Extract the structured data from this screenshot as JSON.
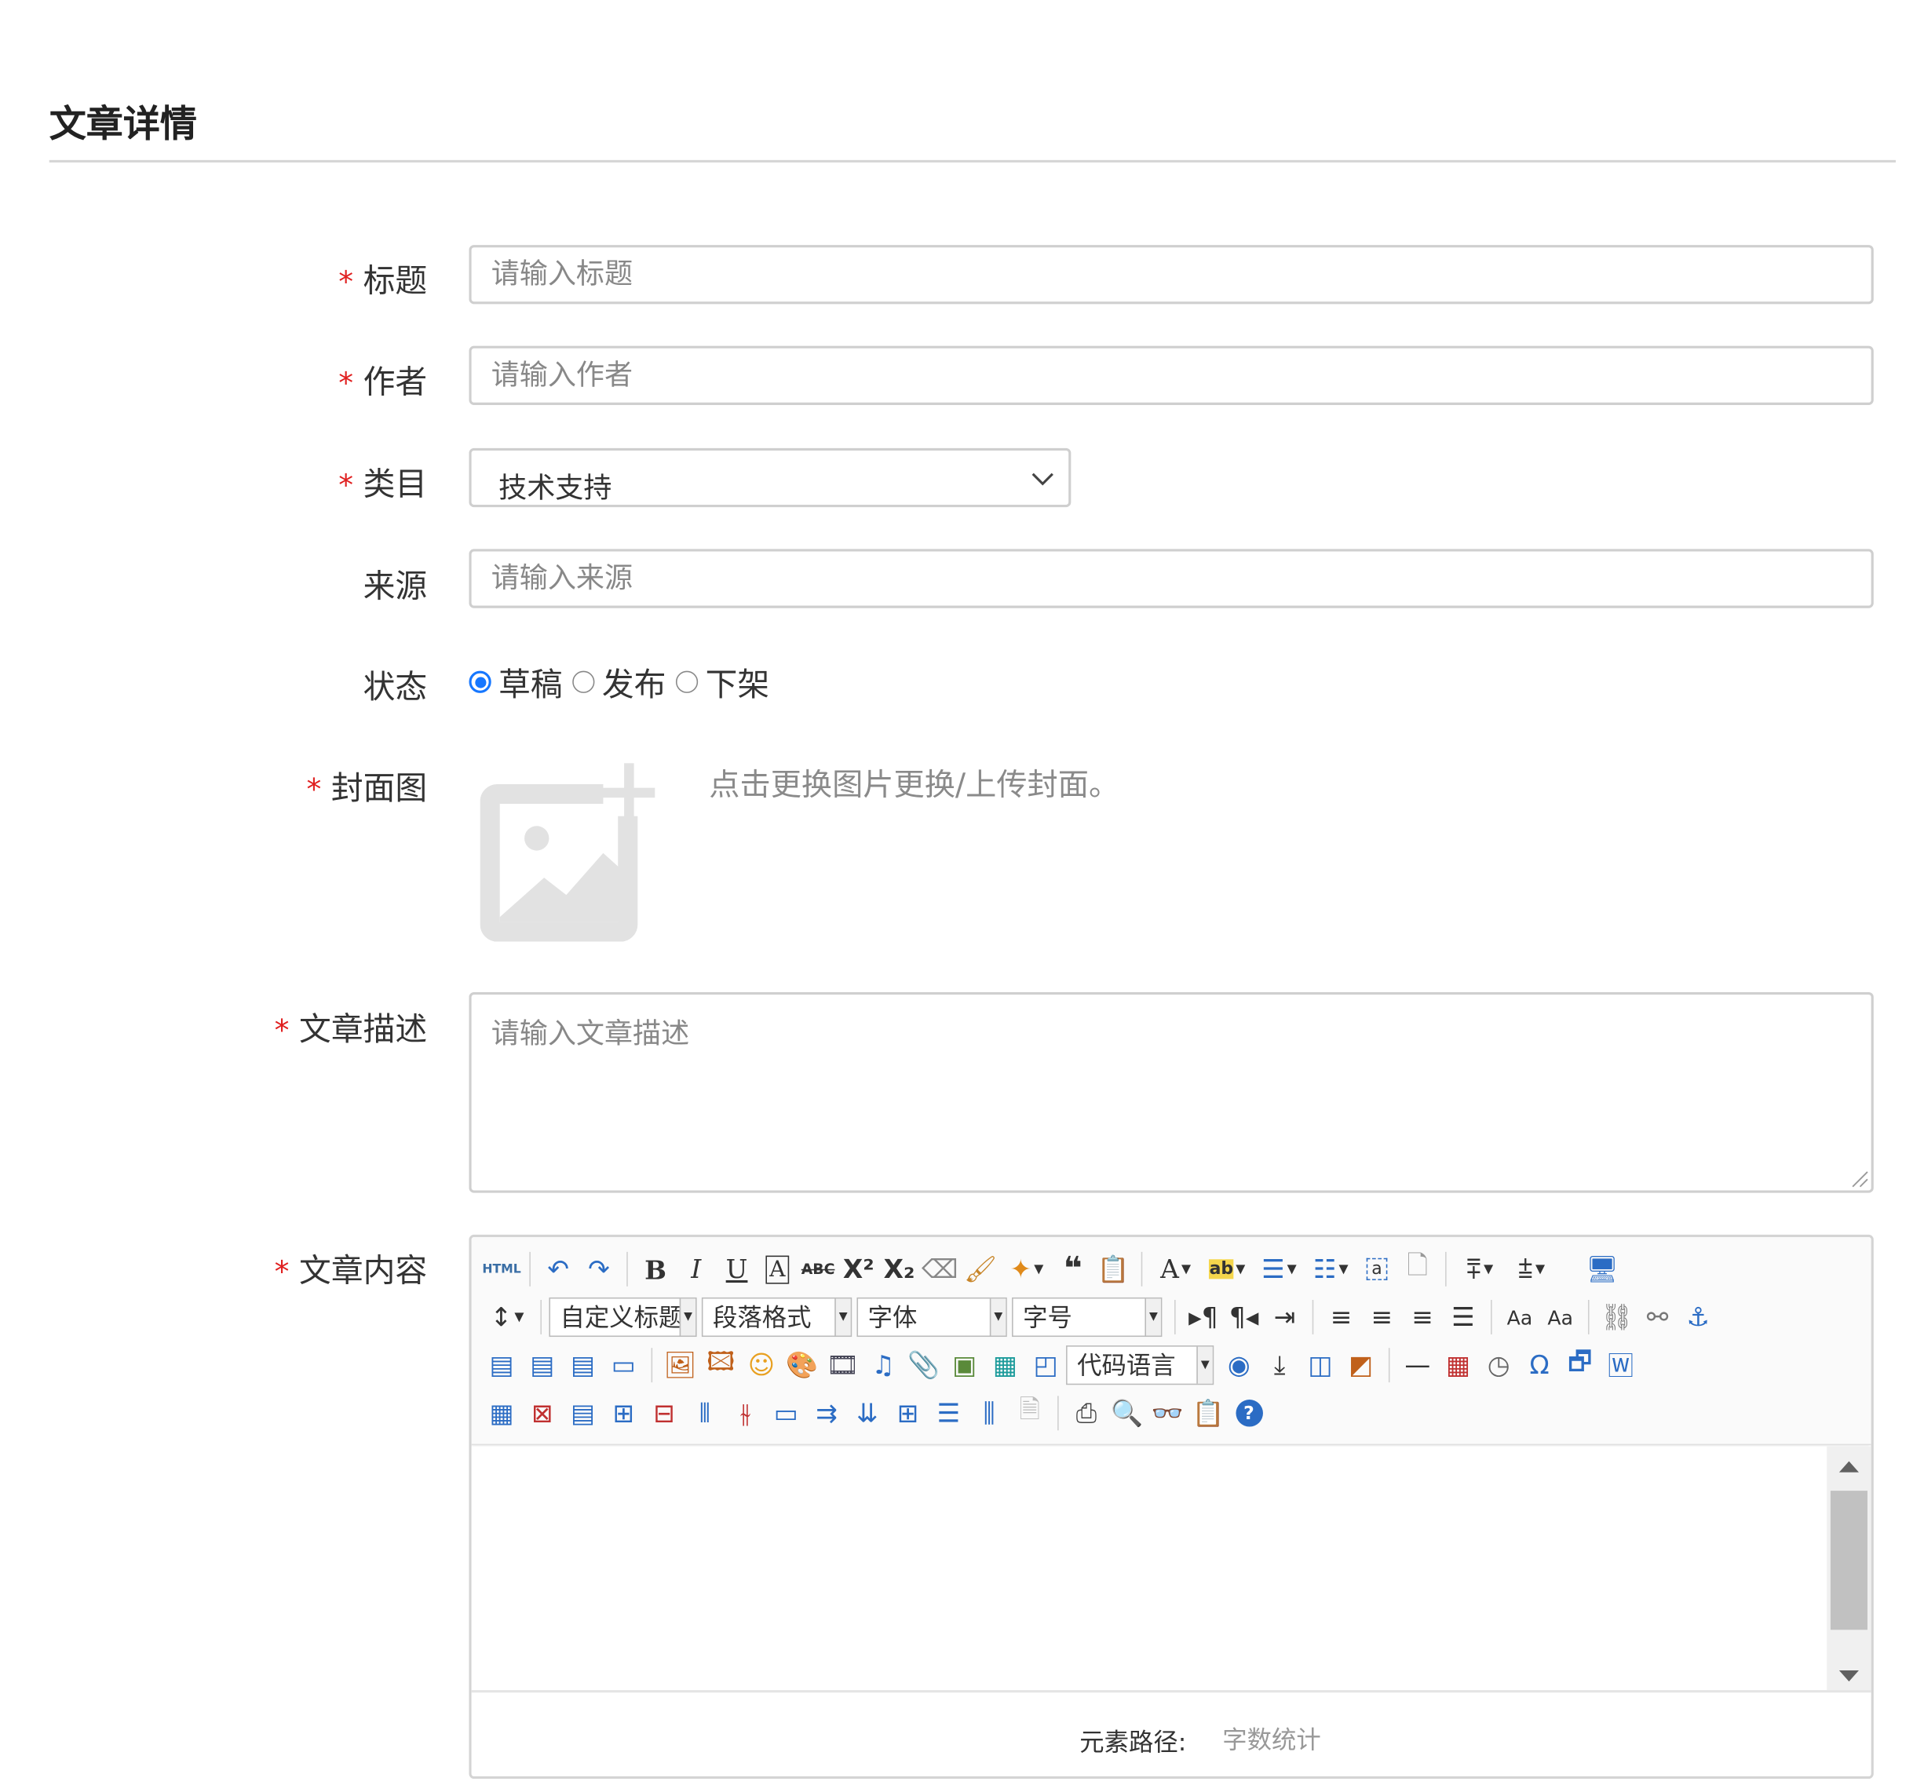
{
  "page": {
    "title": "文章详情"
  },
  "form": {
    "required_mark": "*",
    "title": {
      "label": "标题",
      "placeholder": "请输入标题"
    },
    "author": {
      "label": "作者",
      "placeholder": "请输入作者"
    },
    "category": {
      "label": "类目",
      "selected": "技术支持"
    },
    "source": {
      "label": "来源",
      "placeholder": "请输入来源"
    },
    "status": {
      "label": "状态",
      "options": [
        "草稿",
        "发布",
        "下架"
      ],
      "selected": "草稿"
    },
    "cover": {
      "label": "封面图",
      "tip": "点击更换图片更换/上传封面。"
    },
    "description": {
      "label": "文章描述",
      "placeholder": "请输入文章描述"
    },
    "content": {
      "label": "文章内容"
    }
  },
  "editor": {
    "html_label": "HTML",
    "combos": {
      "custom_heading": "自定义标题",
      "paragraph": "段落格式",
      "font_family": "字体",
      "font_size": "字号",
      "code_language": "代码语言"
    },
    "status": {
      "path_label": "元素路径:",
      "word_count": "字数统计"
    },
    "accent_color": "#1677ff",
    "required_color": "#e02020"
  }
}
